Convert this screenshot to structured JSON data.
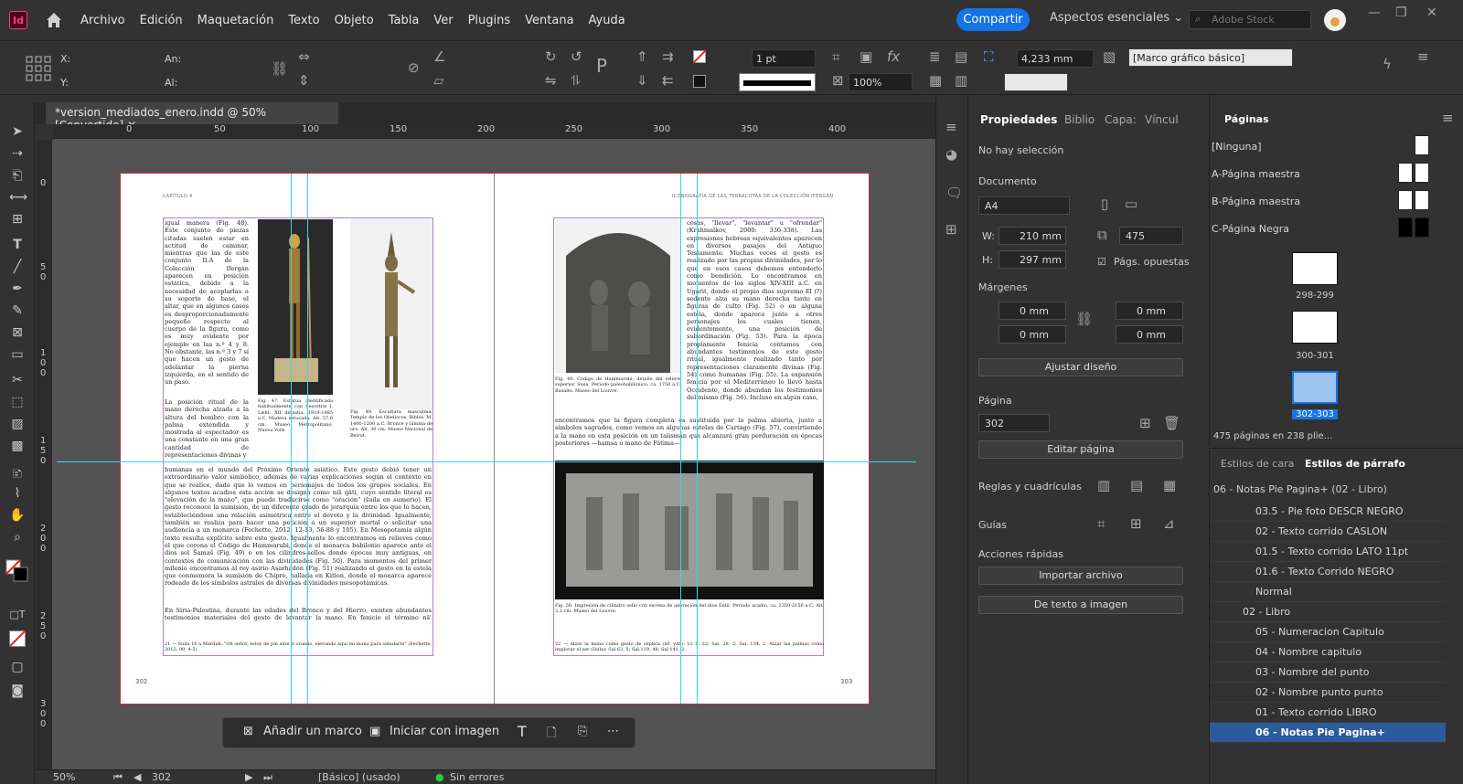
{
  "app": {
    "logo": "Id",
    "menu": [
      "Archivo",
      "Edición",
      "Maquetación",
      "Texto",
      "Objeto",
      "Tabla",
      "Ver",
      "Plugins",
      "Ventana",
      "Ayuda"
    ],
    "share": "Compartir",
    "workspace": "Aspectos esenciales",
    "stock_placeholder": "Adobe Stock"
  },
  "control": {
    "x_label": "X:",
    "y_label": "Y:",
    "w_label": "An:",
    "h_label": "Al:",
    "stroke": "1 pt",
    "scale": "100%",
    "dimension": "4,233 mm",
    "frame_style": "[Marco gráfico básico]"
  },
  "document": {
    "tab": "*version_mediados_enero.indd @ 50% [Convertido]",
    "ruler_h": [
      "0",
      "50",
      "100",
      "150",
      "200",
      "250",
      "300",
      "350",
      "400"
    ],
    "ruler_v": [
      "0",
      "5 0",
      "1 0 0",
      "1 5 0",
      "2 0 0",
      "2 5 0",
      "3 0 0"
    ]
  },
  "spread": {
    "left_head": "CAPÍTULO 4",
    "right_head": "ICONOGRAFÍA DE LAS TERRACOTAS DE LA COLECCIÓN IFERGÁN",
    "left_page": "302",
    "right_page": "303",
    "left_col_top": "igual manera (Fig. 48). Este conjunto de piezas citadas suelen estar en actitud de caminar, mientras que las de este conjunto II.A de la Colección Ifergán aparecen en posición estática, debido a la necesidad de acoplarlas a su soporte de base, el altar, que en algunos casos es desproporcionadamente pequeño respecto al cuerpo de la figura, como es muy evidente por ejemplo en las n.º 4 y 8. No obstante, las n.º 3 y 7 sí que hacen un gesto de adelantar la pierna izquierda, en el sentido de un paso.",
    "left_col_mid": "La posición ritual de la mano derecha alzada a la altura del hombro con la palma extendida y mostrada al espectador es una constante en una gran cantidad de representaciones divinas y",
    "left_main": "humanas en el mundo del Próximo Oriente asiático. Este gesto debió tener un extraordinario valor simbólico, además de varias explicaciones según el contexto en que se realice, dado que lo vemos en personajes de todos los grupos sociales. En algunos textos acadios esta acción se designa como niš qāti, cuyo sentido literal es \"elevación de la mano\", que puede traducirse como \"oración\" (šuila en sumerio). El gesto reconoce la sumisión, de un diferente grado de jerarquía entre los que lo hacen, estableciéndose una relación asimétrica entre el devoto y la divinidad. Igualmente, también se realiza para hacer una petición a un superior mortal o solicitar una audiencia a un monarca (Fechette, 2012: 12-13, 56-88 y 105). En Mesopotamia algún texto resulta explícito sobre este gesto. Igualmente lo encontramos en relieves como el que corona el Código de Hammurabi, donde el monarca babilonio aparece ante el dios sol Šamaš (Fig. 49) o en los cilindros-sellos donde épocas muy antiguas, en contextos de comunicación con las divinidades (Fig. 50). Para momentos del primer milenio encontramos al rey asirio Asarhadón (Fig. 51) realizando el gesto en la estela que conmemora la sumisión de Chipre, hallada en Kition, donde el monarca aparece rodeado de los símbolos astrales de diversas divinidades mesopotámicas.",
    "left_main2": "En Siria-Palestina, durante las edades del Bronce y del Hierro, existen abundantes testimonios materiales del gesto de levantar la mano. En fenicio el término nšʾ significa, entre otras",
    "left_note": "21 — Šuila 16 a Marduk: \"Oh señor, estoy de pie ante ti orando, elevando aquí mi mano para saludarte\" (Fechette, 2012: 90, 4-5).",
    "fig47": "Fig. 47. Estatua identificada habitualmente con Sesostris I. Lisht. XII dinastía, 1919-1885 a.C. Madera estucada. Alt. 57,6 cm. Museo Metropolitano, Nueva York.",
    "fig48": "Fig. 48. Escultura masculina. Templo de los Obeliscos, Biblos. M. 1400-1200 a.C. Bronce y lámina de oro. Alt. 30 cm. Museo Nacional de Beirut.",
    "fig49": "Fig. 49. Código de Hammurabi, detalle del relieve superior. Susa. Periodo paleobabilónico. ca. 1750 a.C. Basalto. Museo del Louvre.",
    "right_col": "cosas, \"llevar\", \"levantar\" u \"ofrendar\" (Krahmalkov, 2000: 336-338). Las expresiones hebreas equivalentes aparecen en diversos pasajes del Antiguo Testamento. Muchas veces el gesto es realizado por las propias divinidades, por lo que en esos casos debemos entenderlo como bendición. Lo encontramos en momentos de los siglos XIV-XIII a.C. en Ugarit, donde el propio dios supremo El (?) sedente alza su mano derecha tanto en figuras de culto (Fig. 52) o en alguna estela, donde aparece junto a otros personajes los cuales tienen, evidentemente, una posición de subordinación (Fig. 53). Para la época propiamente fenicia contamos con abundantes testimonios de este gesto ritual, igualmente realizado tanto por representaciones claramente divinas (Fig. 54) como humanas (Fig. 55). La expansión fenicia por el Mediterráneo lo llevó hasta Occidente, donde abundan los testimonios del mismo (Fig. 56). Incluso en algún caso,",
    "right_main": "encontramos que la figura completa es sustituida por la palma abierta, junto a símbolos sagrados, como vemos en algunas estelas de Cartago (Fig. 57), convirtiendo a la mano en esta posición en un talismán que alcanzará gran perduración en épocas posteriores —hamsa o mano de Fátima—.",
    "fig50": "Fig. 50. Impresión de cilindro sello con escena de adoración del dios Enlil. Periodo acadio, ca. 2350-2150 a.C. Alt. 3,2 cm. Museo del Louvre.",
    "right_note": "22 — Alzar la mano como gesto de súplica (nšʾ ydh): Lv 9, 22; Sal. 28, 2; Sal. 134, 2. Alzar las palmas como implorar el ser (šuila): Sal.63, 5; Sal.119, 48; Sal 141, 2."
  },
  "bottom_bar": {
    "add_frame": "Añadir un marco",
    "start_image": "Iniciar con imagen"
  },
  "status": {
    "zoom": "50%",
    "page": "302",
    "master": "[Básico] (usado)",
    "errors": "Sin errores"
  },
  "properties": {
    "tabs": [
      "Propiedades",
      "Biblio",
      "Capa:",
      "Víncul"
    ],
    "no_selection": "No hay selección",
    "document_label": "Documento",
    "size": "A4",
    "w_label": "W:",
    "w": "210 mm",
    "h_label": "H:",
    "h": "297 mm",
    "pages_count": "475",
    "facing": "Págs. opuestas",
    "margins_label": "Márgenes",
    "margin_top": "0 mm",
    "margin_bottom": "0 mm",
    "margin_left": "0 mm",
    "margin_right": "0 mm",
    "adjust_layout": "Ajustar diseño",
    "page_label": "Página",
    "page": "302",
    "edit_page": "Editar página",
    "rulers_grids": "Reglas y cuadrículas",
    "guides": "Guías",
    "quick_actions": "Acciones rápidas",
    "import_file": "Importar archivo",
    "text_to_image": "De texto a imagen"
  },
  "pages_panel": {
    "title": "Páginas",
    "masters": [
      "[Ninguna]",
      "A-Página maestra",
      "B-Página maestra",
      "C-Página Negra"
    ],
    "spreads": [
      {
        "label": "298-299",
        "selected": false
      },
      {
        "label": "300-301",
        "selected": false
      },
      {
        "label": "302-303",
        "selected": true
      }
    ],
    "footer": "475 páginas en 238 plie..."
  },
  "styles_panel": {
    "tabs": [
      "Estilos de cara",
      "Estilos de párrafo"
    ],
    "current": "06 - Notas Pie Pagina+ (02 - Libro)",
    "items": [
      "03.5 - Pie foto DESCR NEGRO",
      "02 - Texto corrido CASLON",
      "01.5 - Texto corrido LATO 11pt",
      "01.6 - Texto Corrido NEGRO",
      "Normal"
    ],
    "group": "02 - Libro",
    "group_items": [
      "05 - Numeracion Capitulo",
      "04 - Nombre capitulo",
      "03 - Nombre del punto",
      "02 - Nombre punto punto",
      "01 - Texto corrido LIBRO",
      "06 - Notas Pie Pagina+"
    ]
  },
  "colors": {
    "accent": "#1473e6",
    "guide": "#34d7e6",
    "frame": "#b77bd6",
    "bleed": "#c7323d"
  }
}
